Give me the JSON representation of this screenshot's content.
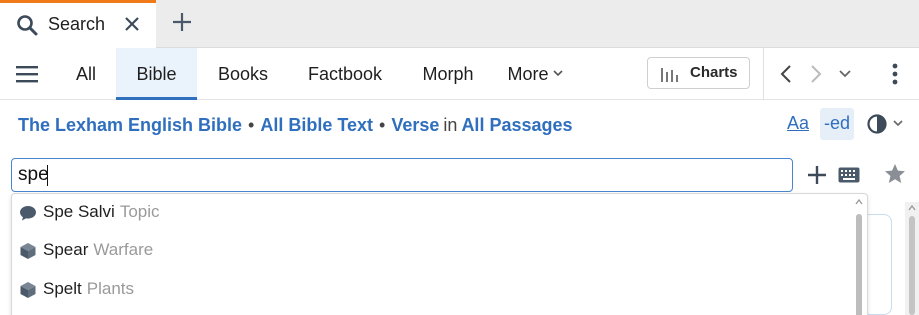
{
  "tab": {
    "label": "Search",
    "search_icon": "search-icon",
    "close_icon": "close-icon"
  },
  "new_tab_icon": "plus-icon",
  "toolbar": {
    "menu_icon": "hamburger-icon",
    "tabs": [
      {
        "label": "All",
        "active": false
      },
      {
        "label": "Bible",
        "active": true
      },
      {
        "label": "Books",
        "active": false
      },
      {
        "label": "Factbook",
        "active": false
      },
      {
        "label": "Morph",
        "active": false
      },
      {
        "label": "More",
        "active": false
      }
    ],
    "charts_label": "Charts",
    "back_icon": "chevron-left-icon",
    "forward_icon": "chevron-right-icon",
    "history_icon": "chevron-down-icon",
    "more_icon": "kebab-icon"
  },
  "scope": {
    "resource": "The Lexham English Bible",
    "text_scope": "All Bible Text",
    "unit": "Verse",
    "in_label": "in",
    "range": "All Passages",
    "font_button": "Aa",
    "ed_button": "-ed"
  },
  "search": {
    "value": "spe"
  },
  "suggestions": [
    {
      "name": "Spe Salvi",
      "category": "Topic",
      "icon": "speech-bubble-icon"
    },
    {
      "name": "Spear",
      "category": "Warfare",
      "icon": "cube-icon"
    },
    {
      "name": "Spelt",
      "category": "Plants",
      "icon": "cube-icon"
    }
  ],
  "colors": {
    "accent": "#2f6fbe",
    "tab_highlight": "#f07a1a",
    "muted": "#9a9a9a"
  }
}
